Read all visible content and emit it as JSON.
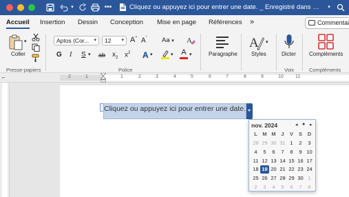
{
  "titlebar": {
    "title": "Cliquez ou appuyez ici pour entrer une date.",
    "saved_status": " _ Enregistré dans mon Mac"
  },
  "tabs": [
    {
      "label": "Accueil",
      "active": true
    },
    {
      "label": "Insertion",
      "active": false
    },
    {
      "label": "Dessin",
      "active": false
    },
    {
      "label": "Conception",
      "active": false
    },
    {
      "label": "Mise en page",
      "active": false
    },
    {
      "label": "Références",
      "active": false
    }
  ],
  "tabs_more_glyph": "»",
  "comments_button": {
    "label": "Commentaires"
  },
  "ribbon": {
    "clipboard": {
      "paste_label": "Coller",
      "group_label": "Presse-papiers"
    },
    "font": {
      "font_name": "Aptos (Cor...",
      "font_size": "12",
      "grow_label": "A",
      "shrink_label": "A",
      "case_label": "Aa",
      "bold": "G",
      "italic": "I",
      "underline": "S",
      "strike": "ab",
      "subscript_base": "x",
      "subscript_mark": "2",
      "superscript_base": "x",
      "superscript_mark": "2",
      "effects": "A",
      "highlight": "A",
      "color": "A",
      "group_label": "Police"
    },
    "paragraph": {
      "label": "Paragraphe"
    },
    "styles": {
      "label": "Styles"
    },
    "voice": {
      "dictate_label": "Dicter",
      "group_label": "Voix"
    },
    "addins": {
      "label": "Compléments",
      "group_label": "Compléments"
    }
  },
  "ruler": {
    "numbers": [
      "2",
      "1",
      "1",
      "2",
      "3",
      "4",
      "5",
      "6",
      "7",
      "8",
      "9",
      "10",
      "11"
    ]
  },
  "document": {
    "placeholder": "Cliquez ou appuyez ici pour entrer une date."
  },
  "datepicker": {
    "month_label": "nov. 2024",
    "prev_glyph": "◂",
    "today_glyph": "●",
    "next_glyph": "▸",
    "weekdays": [
      "L",
      "M",
      "M",
      "J",
      "V",
      "S",
      "D"
    ],
    "weeks": [
      [
        "28",
        "29",
        "30",
        "31",
        "1",
        "2",
        "3"
      ],
      [
        "4",
        "5",
        "6",
        "7",
        "8",
        "9",
        "10"
      ],
      [
        "11",
        "12",
        "13",
        "14",
        "15",
        "16",
        "17"
      ],
      [
        "18",
        "19",
        "20",
        "21",
        "22",
        "23",
        "24"
      ],
      [
        "25",
        "26",
        "27",
        "28",
        "29",
        "30",
        "1"
      ],
      [
        "2",
        "3",
        "4",
        "5",
        "6",
        "7",
        "8"
      ]
    ],
    "selected_day": "19"
  },
  "colors": {
    "accent": "#2b579a",
    "ribbon_bg": "#f3f3f3",
    "highlight_yellow": "#f2e600",
    "font_red": "#e02020",
    "addins_red": "#d13438"
  }
}
